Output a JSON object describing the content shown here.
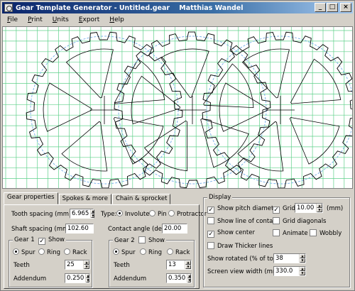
{
  "titlebar": {
    "title": "Gear Template Generator - Untitled.gear    Matthias Wandel",
    "min": "_",
    "max": "□",
    "close": "×"
  },
  "menu": [
    {
      "first": "F",
      "rest": "ile"
    },
    {
      "first": "P",
      "rest": "rint"
    },
    {
      "first": "U",
      "rest": "nits"
    },
    {
      "first": "E",
      "rest": "xport"
    },
    {
      "first": "H",
      "rest": "elp"
    }
  ],
  "tabs": [
    "Gear properties",
    "Spokes & more",
    "Chain & sprocket"
  ],
  "gear_props": {
    "tooth_spacing_label": "Tooth spacing (mm)",
    "tooth_spacing": "6.965",
    "shaft_spacing_label": "Shaft spacing (mm)",
    "shaft_spacing": "102.60",
    "type_label": "Type:",
    "type_options": [
      "Involute",
      "Pin",
      "Protractor"
    ],
    "type_selected": "Involute",
    "contact_angle_label": "Contact angle (deg)",
    "contact_angle": "20.00",
    "gear1": {
      "title": "Gear 1",
      "show_label": "Show",
      "show": true,
      "kinds": [
        "Spur",
        "Ring",
        "Rack"
      ],
      "kind": "Spur",
      "teeth_label": "Teeth",
      "teeth": "25",
      "addendum_label": "Addendum",
      "addendum": "0.250"
    },
    "gear2": {
      "title": "Gear 2",
      "show_label": "Show",
      "show": false,
      "kinds": [
        "Spur",
        "Ring",
        "Rack"
      ],
      "kind": "Spur",
      "teeth_label": "Teeth",
      "teeth": "13",
      "addendum_label": "Addendum",
      "addendum": "0.350"
    }
  },
  "display": {
    "title": "Display",
    "show_pitch_diameter": {
      "label": "Show pitch diameter",
      "checked": true
    },
    "show_line_of_contact": {
      "label": "Show line of contact",
      "checked": false
    },
    "show_center": {
      "label": "Show center",
      "checked": true
    },
    "draw_thicker": {
      "label": "Draw Thicker lines",
      "checked": false
    },
    "grid": {
      "label": "Grid",
      "checked": true,
      "value": "10.00",
      "unit": "(mm)"
    },
    "grid_diagonals": {
      "label": "Grid diagonals",
      "checked": false
    },
    "animate": {
      "label": "Animate",
      "checked": false
    },
    "wobbly": {
      "label": "Wobbly",
      "checked": false
    },
    "show_rotated_label": "Show rotated (% of tooth)",
    "show_rotated": "38",
    "screen_width_label": "Screen view width (mm)",
    "screen_width": "330.0"
  },
  "colors": {
    "grid": "#5fd08a",
    "pitch": "#7fb4ea",
    "gear": "#000000",
    "title_start": "#0a246a"
  }
}
